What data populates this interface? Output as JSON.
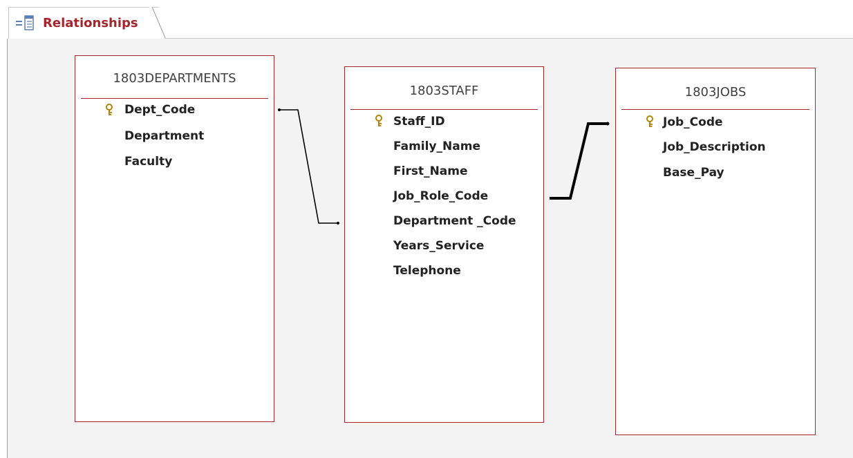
{
  "tab": {
    "label": "Relationships",
    "icon": "relationships-icon"
  },
  "tables": [
    {
      "name": "1803DEPARTMENTS",
      "fields": [
        "Dept_Code",
        "Department",
        "Faculty"
      ],
      "key_field": "Dept_Code"
    },
    {
      "name": "1803STAFF",
      "fields": [
        "Staff_ID",
        "Family_Name",
        "First_Name",
        "Job_Role_Code",
        "Department _Code",
        "Years_Service",
        "Telephone"
      ],
      "key_field": "Staff_ID"
    },
    {
      "name": "1803JOBS",
      "fields": [
        "Job_Code",
        "Job_Description",
        "Base_Pay"
      ],
      "key_field": "Job_Code"
    }
  ],
  "relationships": [
    {
      "from": "1803DEPARTMENTS.Dept_Code",
      "to": "1803STAFF.Department _Code",
      "enforced": false
    },
    {
      "from": "1803JOBS.Job_Code",
      "to": "1803STAFF.Job_Role_Code",
      "enforced": true
    }
  ],
  "colors": {
    "accent": "#a4262c",
    "canvas": "#f3f3f3",
    "key": "#d8a400"
  }
}
